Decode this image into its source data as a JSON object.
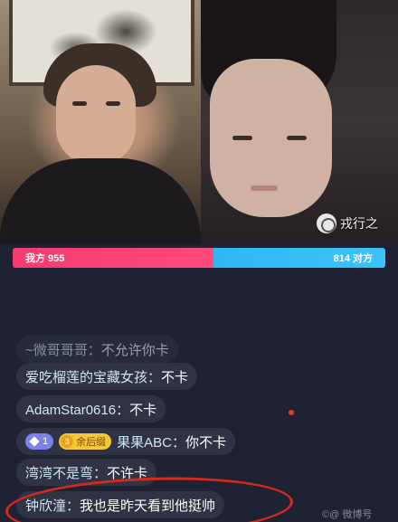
{
  "stream": {
    "host_name": "戎行之"
  },
  "pk": {
    "left_label": "我方 955",
    "right_label": "814 对方",
    "left_score": 955,
    "right_score": 814,
    "colors": {
      "ours": "#f53b6f",
      "theirs": "#2fb8f5"
    }
  },
  "chat": {
    "messages": [
      {
        "user": "~微哥哥哥：",
        "text": "不允许你卡"
      },
      {
        "user": "爱吃榴莲的宝藏女孩：",
        "text": "不卡"
      },
      {
        "user": "AdamStar0616：",
        "text": "不卡"
      },
      {
        "level_badge": "1",
        "fan_level": "3",
        "fan_badge": "余后缀",
        "user": "果果ABC：",
        "text": "你不卡"
      },
      {
        "user": "湾湾不是弯：",
        "text": "不许卡"
      },
      {
        "user": "钟欣潼：",
        "text": "我也是昨天看到他挺帅"
      }
    ]
  },
  "overlay": {
    "watermark": "©@ 微博号"
  }
}
